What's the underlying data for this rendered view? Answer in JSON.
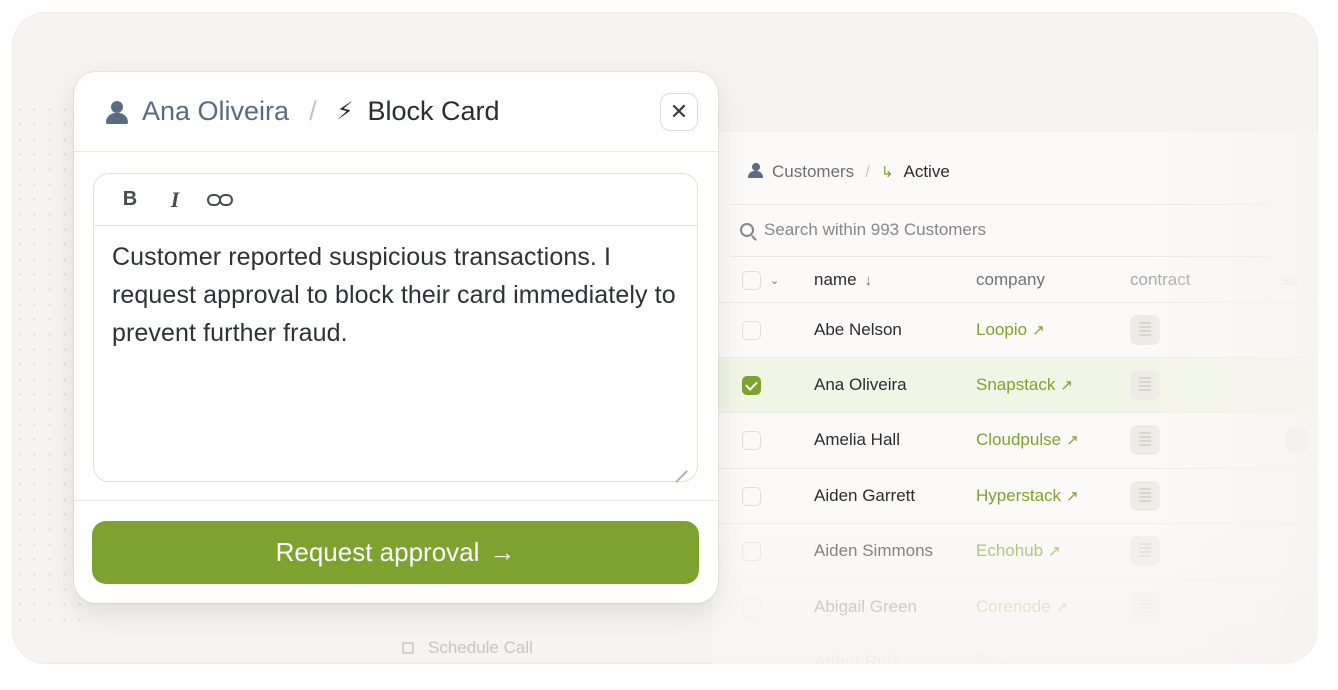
{
  "modal": {
    "breadcrumb_person": "Ana Oliveira",
    "breadcrumb_separator": "/",
    "breadcrumb_action": "Block Card",
    "close_symbol": "✕",
    "toolbar": {
      "bold": "B",
      "italic": "I"
    },
    "message": "Customer reported suspicious transactions. I request approval to block their card immediately to prevent further fraud.",
    "submit_label": "Request approval",
    "submit_arrow": "→"
  },
  "background_table": {
    "breadcrumb": {
      "root": "Customers",
      "separator": "/",
      "current": "Active"
    },
    "search_placeholder": "Search within 993 Customers",
    "columns": {
      "name": "name",
      "company": "company",
      "contract": "contract",
      "extra": "su"
    },
    "rows": [
      {
        "name": "Abe Nelson",
        "company": "Loopio",
        "selected": false
      },
      {
        "name": "Ana Oliveira",
        "company": "Snapstack",
        "selected": true
      },
      {
        "name": "Amelia Hall",
        "company": "Cloudpulse",
        "selected": false
      },
      {
        "name": "Aiden Garrett",
        "company": "Hyperstack",
        "selected": false
      },
      {
        "name": "Aiden Simmons",
        "company": "Echohub",
        "selected": false
      },
      {
        "name": "Abigail Green",
        "company": "Corenode",
        "selected": false
      },
      {
        "name": "Arthur Ruiz",
        "company": "Flowstack",
        "selected": false
      }
    ],
    "external_link_symbol": "↗"
  },
  "background_menu": {
    "schedule_call": "Schedule Call"
  },
  "colors": {
    "accent": "#7ea230",
    "person_icon": "#5b6b82",
    "frame_bg": "#f6f4f1"
  },
  "icons": [
    "user-icon",
    "bolt-icon",
    "close-icon",
    "bold-icon",
    "italic-icon",
    "link-icon",
    "search-icon",
    "sort-down-icon",
    "external-link-icon",
    "calendar-icon"
  ]
}
